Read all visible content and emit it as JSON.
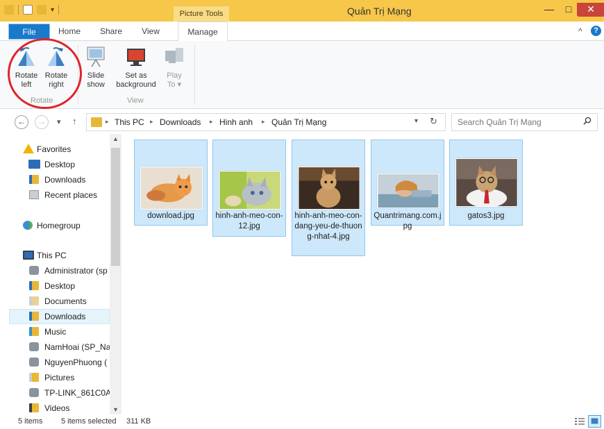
{
  "window": {
    "title": "Quản Trị Mạng",
    "contextual_tab_group": "Picture Tools",
    "minimize_glyph": "—",
    "maximize_glyph": "□",
    "close_glyph": "✕"
  },
  "tabs": {
    "file": "File",
    "home": "Home",
    "share": "Share",
    "view": "View",
    "manage": "Manage",
    "collapse_glyph": "^",
    "help_glyph": "?"
  },
  "ribbon": {
    "rotate_left": "Rotate\nleft",
    "rotate_right": "Rotate\nright",
    "rotate_group": "Rotate",
    "slide_show": "Slide\nshow",
    "set_background": "Set as\nbackground",
    "play_to": "Play\nTo ▾",
    "view_group": "View"
  },
  "address": {
    "back_glyph": "←",
    "forward_glyph": "→",
    "recent_glyph": "▾",
    "up_glyph": "↑",
    "crumbs": [
      "This PC",
      "Downloads",
      "Hinh anh",
      "Quản Trị Mạng"
    ],
    "dropdown_glyph": "▾",
    "refresh_glyph": "↻",
    "search_placeholder": "Search Quản Trị Mạng"
  },
  "nav": {
    "items": [
      {
        "label": "Favorites",
        "icon": "star-icon"
      },
      {
        "label": "Desktop",
        "icon": "desktop-icon"
      },
      {
        "label": "Downloads",
        "icon": "downloads-folder-icon"
      },
      {
        "label": "Recent places",
        "icon": "recent-places-icon"
      },
      {
        "label": "Homegroup",
        "icon": "homegroup-icon"
      },
      {
        "label": "This PC",
        "icon": "computer-icon"
      },
      {
        "label": "Administrator (sp",
        "icon": "network-user-icon"
      },
      {
        "label": "Desktop",
        "icon": "desktop-folder-icon"
      },
      {
        "label": "Documents",
        "icon": "documents-folder-icon"
      },
      {
        "label": "Downloads",
        "icon": "downloads-folder-icon"
      },
      {
        "label": "Music",
        "icon": "music-folder-icon"
      },
      {
        "label": "NamHoai (SP_Na",
        "icon": "network-user-icon"
      },
      {
        "label": "NguyenPhuong (",
        "icon": "network-user-icon"
      },
      {
        "label": "Pictures",
        "icon": "pictures-folder-icon"
      },
      {
        "label": "TP-LINK_861C0A",
        "icon": "network-user-icon"
      },
      {
        "label": "Videos",
        "icon": "videos-folder-icon"
      }
    ],
    "scroll_up_glyph": "▲",
    "scroll_down_glyph": "▼"
  },
  "files": [
    {
      "name": "download.jpg"
    },
    {
      "name": "hinh-anh-meo-con-12.jpg"
    },
    {
      "name": "hinh-anh-meo-con-dang-yeu-de-thuong-nhat-4.jpg"
    },
    {
      "name": "Quantrimang.com.jpg"
    },
    {
      "name": "gatos3.jpg"
    }
  ],
  "status": {
    "count": "5 items",
    "selected": "5 items selected",
    "size": "311 KB"
  },
  "colors": {
    "titlebar": "#f7c74a",
    "file_tab": "#1979ca",
    "selection": "#cde8fb",
    "highlight_circle": "#e0232b"
  }
}
